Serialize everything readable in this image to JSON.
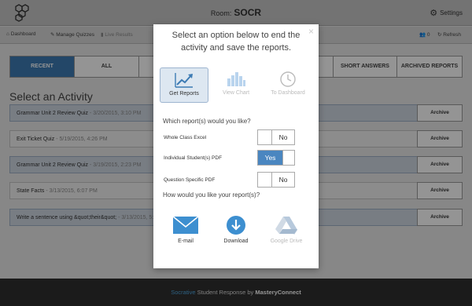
{
  "header": {
    "room_label": "Room:",
    "room_name": "SOCR",
    "settings_label": "Settings"
  },
  "subnav": {
    "dashboard": "Dashboard",
    "manage_quizzes": "Manage Quizzes",
    "live_results": "Live Results",
    "count": "0",
    "refresh": "Refresh"
  },
  "tabs": [
    "RECENT",
    "ALL",
    "SHORT ANSWERS",
    "ARCHIVED REPORTS"
  ],
  "section_title": "Select an Activity",
  "activities": [
    {
      "title": "Grammar Unit 2 Review Quiz",
      "date": "- 3/20/2015, 3:10 PM",
      "action": "Archive"
    },
    {
      "title": "Exit Ticket Quiz",
      "date": "- 5/19/2015, 4:26 PM",
      "action": "Archive"
    },
    {
      "title": "Grammar Unit 2 Review Quiz",
      "date": "- 3/19/2015, 2:23 PM",
      "action": "Archive"
    },
    {
      "title": "State Facts",
      "date": "- 3/13/2015, 6:07 PM",
      "action": "Archive"
    },
    {
      "title": "Write a sentence using &quot;their&quot;",
      "date": "- 3/13/2015, 5:",
      "action": "Archive"
    }
  ],
  "footer": {
    "brand": "Socrative",
    "middle": " Student Response by ",
    "company": "MasteryConnect"
  },
  "modal": {
    "heading": "Select an option below to end the activity and save the reports.",
    "close": "×",
    "options": [
      {
        "label": "Get Reports",
        "selected": true
      },
      {
        "label": "View Chart",
        "selected": false
      },
      {
        "label": "To Dashboard",
        "selected": false
      }
    ],
    "question1": "Which report(s) would you like?",
    "reports": [
      {
        "label": "Whole Class Excel",
        "value": "No"
      },
      {
        "label": "Individual Student(s) PDF",
        "value": "Yes"
      },
      {
        "label": "Question Specific PDF",
        "value": "No"
      }
    ],
    "question2": "How would you like your report(s)?",
    "delivery": [
      {
        "label": "E-mail",
        "icon": "envelope-icon"
      },
      {
        "label": "Download",
        "icon": "download-icon"
      },
      {
        "label": "Google Drive",
        "icon": "google-drive-icon"
      }
    ]
  },
  "colors": {
    "accent": "#4a86c0",
    "tab_active": "#3d7bb4",
    "footer_brand": "#4fa7e0"
  }
}
